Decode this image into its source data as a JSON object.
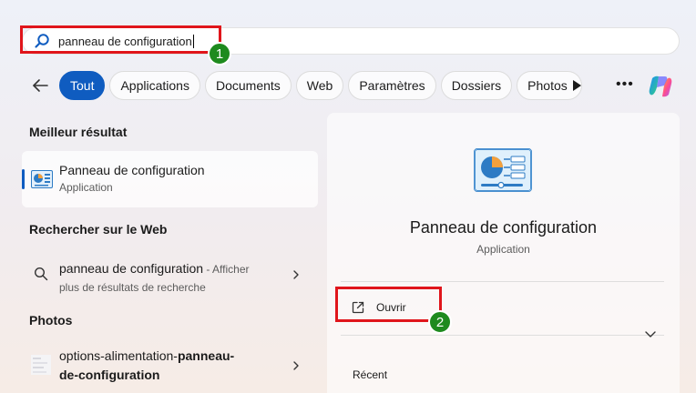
{
  "search": {
    "query": "panneau de configuration"
  },
  "annotations": {
    "step1": "1",
    "step2": "2"
  },
  "filters": {
    "back_icon": "back-arrow-icon",
    "chips": [
      "Tout",
      "Applications",
      "Documents",
      "Web",
      "Paramètres",
      "Dossiers",
      "Photos"
    ],
    "active": "Tout",
    "more_icon": "more-dots-icon"
  },
  "results": {
    "best_heading": "Meilleur résultat",
    "best": {
      "title": "Panneau de configuration",
      "subtitle": "Application"
    },
    "web_heading": "Rechercher sur le Web",
    "web": {
      "query": "panneau de configuration",
      "suffix": " - Afficher",
      "line2": "plus de résultats de recherche"
    },
    "photos_heading": "Photos",
    "photo": {
      "line1_prefix": "options-alimentation-",
      "line1_bold": "panneau-",
      "line2": "de-configuration"
    }
  },
  "detail": {
    "title": "Panneau de configuration",
    "subtitle": "Application",
    "open_label": "Ouvrir",
    "recent_label": "Récent"
  },
  "colors": {
    "accent": "#0f5cc0",
    "highlight": "#e0151b",
    "badge": "#1e8a1e"
  }
}
